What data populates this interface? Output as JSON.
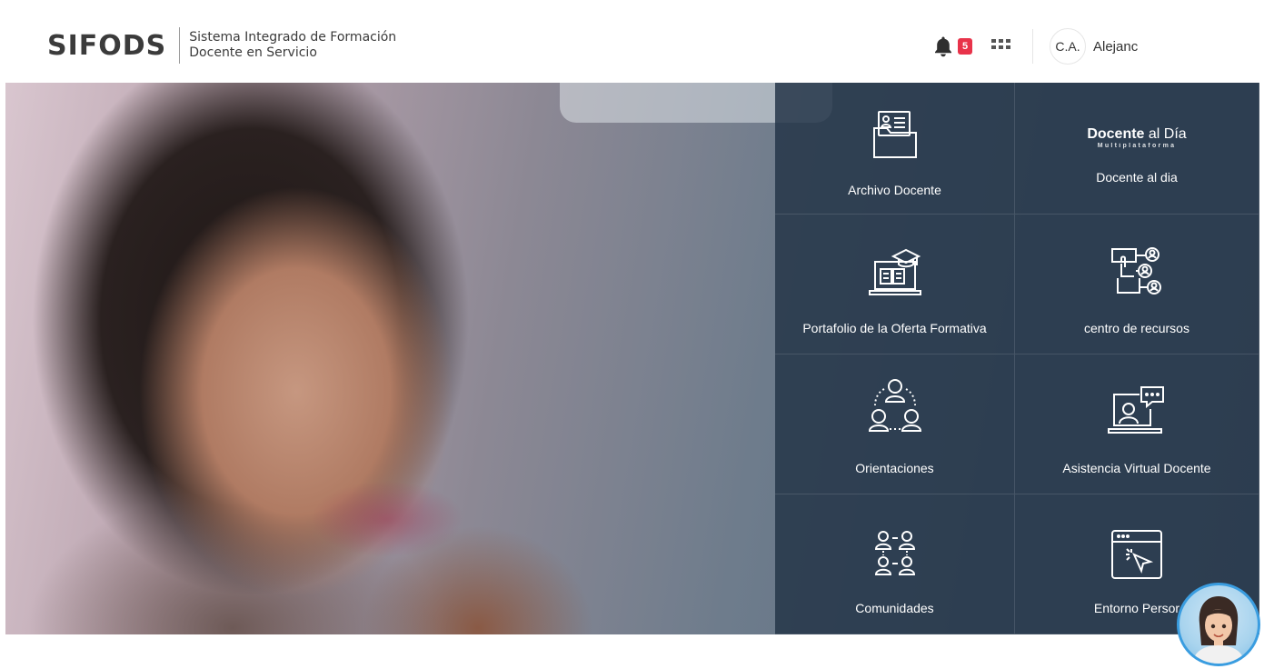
{
  "header": {
    "logo": "SIFODS",
    "subtitle_line1": "Sistema Integrado de Formación",
    "subtitle_line2": "Docente en Servicio",
    "notifications_count": "5",
    "user_initials": "C.A.",
    "user_name": "Alejanc"
  },
  "tiles": [
    {
      "label": "Archivo Docente",
      "icon": "folder-id-card-icon"
    },
    {
      "label": "Docente al dia",
      "icon": "docente-al-dia-logo",
      "logo_bold": "Docente",
      "logo_rest": " al Día",
      "logo_sub": "Multiplataforma"
    },
    {
      "label": "Portafolio de la Oferta Formativa",
      "icon": "laptop-graduation-icon"
    },
    {
      "label": "centro de recursos",
      "icon": "network-users-icon"
    },
    {
      "label": "Orientaciones",
      "icon": "group-orientation-icon"
    },
    {
      "label": "Asistencia Virtual Docente",
      "icon": "virtual-assistance-icon"
    },
    {
      "label": "Comunidades",
      "icon": "community-icon"
    },
    {
      "label": "Entorno Persor",
      "icon": "browser-click-icon"
    }
  ],
  "colors": {
    "tile_bg": "#243448",
    "badge": "#e8334a",
    "assistant_border": "#3a9de0"
  }
}
